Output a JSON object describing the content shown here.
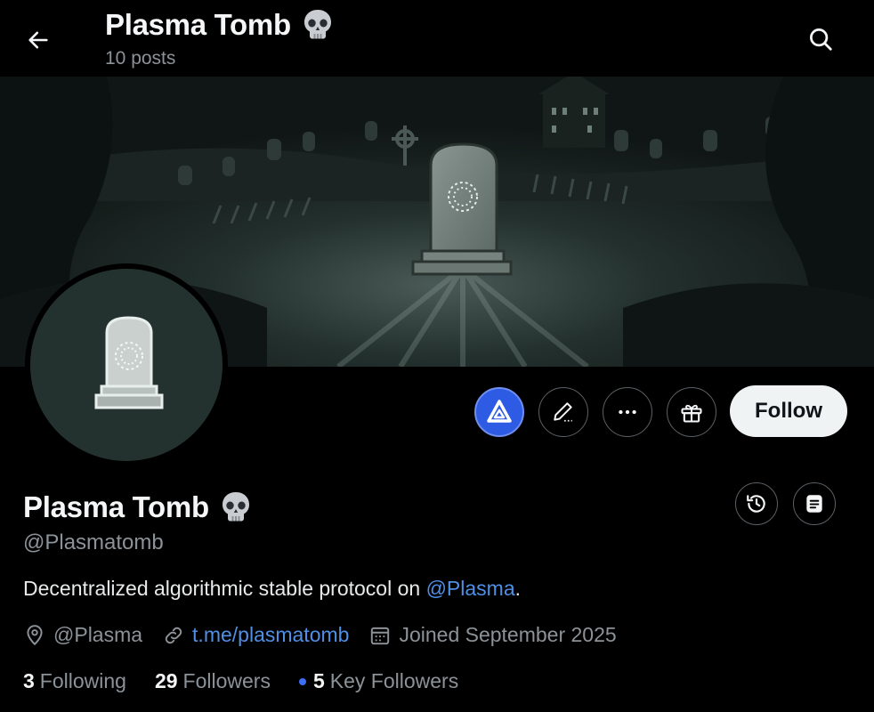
{
  "header": {
    "title": "Plasma Tomb",
    "posts": "10 posts"
  },
  "actions": {
    "follow_label": "Follow"
  },
  "profile": {
    "display_name": "Plasma Tomb",
    "handle": "@Plasmatomb",
    "bio_text": "Decentralized algorithmic stable protocol on ",
    "bio_mention": "@Plasma",
    "bio_end": "."
  },
  "meta": {
    "location": "@Plasma",
    "link": "t.me/plasmatomb",
    "joined": "Joined September 2025"
  },
  "stats": {
    "following_count": "3",
    "following_label": "Following",
    "followers_count": "29",
    "followers_label": "Followers",
    "key_followers_count": "5",
    "key_followers_label": "Key Followers"
  },
  "icons": {
    "back": "arrow-left-icon",
    "search": "search-icon",
    "title_emoji": "skull-icon",
    "plasma": "plasma-logo-icon",
    "edit": "pen-icon",
    "more": "more-icon",
    "gift": "gift-icon",
    "history": "history-icon",
    "notes": "notes-icon",
    "location": "location-pin-icon",
    "link": "link-icon",
    "calendar": "calendar-icon"
  },
  "colors": {
    "background": "#000000",
    "link": "#4f8fe4",
    "plasma_blue": "#2d5be3",
    "muted_text": "#8b9298",
    "avatar_bg": "#23322e",
    "key_follower_dot": "#3d6ef5"
  }
}
